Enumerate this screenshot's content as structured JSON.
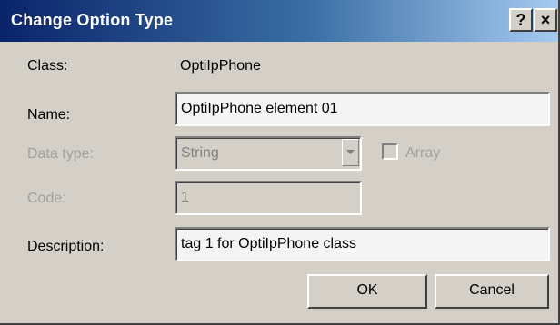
{
  "window": {
    "title": "Change Option Type",
    "help_label": "?",
    "close_label": "×"
  },
  "form": {
    "class_label": "Class:",
    "class_value": "OptiIpPhone",
    "name_label": "Name:",
    "name_value": "OptiIpPhone element 01",
    "datatype_label": "Data type:",
    "datatype_value": "String",
    "array_label": "Array",
    "code_label": "Code:",
    "code_value": "1",
    "description_label": "Description:",
    "description_value": "tag 1 for OptiIpPhone class"
  },
  "buttons": {
    "ok_label": "OK",
    "cancel_label": "Cancel"
  },
  "colors": {
    "title_start": "#0a246a",
    "title_end": "#a6caf0",
    "dialog_bg": "#d4d0c8"
  }
}
